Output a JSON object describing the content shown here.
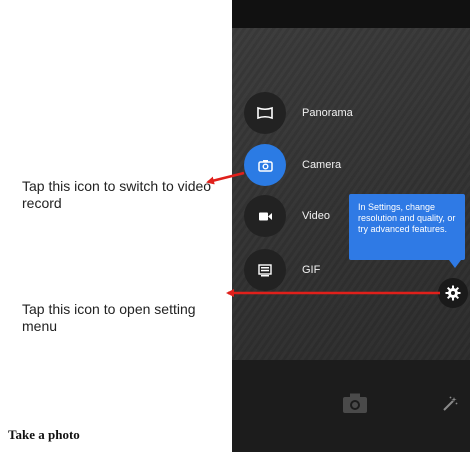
{
  "captions": {
    "switch_video": "Tap this icon to switch to video record",
    "open_settings": "Tap this icon to open setting menu"
  },
  "heading": "Take a photo",
  "modes": [
    {
      "label": "Panorama",
      "icon": "panorama-icon",
      "active": false
    },
    {
      "label": "Camera",
      "icon": "camera-icon",
      "active": true
    },
    {
      "label": "Video",
      "icon": "video-icon",
      "active": false
    },
    {
      "label": "GIF",
      "icon": "gif-icon",
      "active": false
    }
  ],
  "tooltip": {
    "text": "In Settings, change resolution and quality, or try advanced features."
  },
  "icons": {
    "settings": "gear-icon",
    "shutter": "camera-shutter-icon",
    "effects": "magic-wand-icon"
  },
  "colors": {
    "accent": "#2b7be4",
    "arrow": "#e0201b",
    "tooltip": "#2f7ae5"
  }
}
